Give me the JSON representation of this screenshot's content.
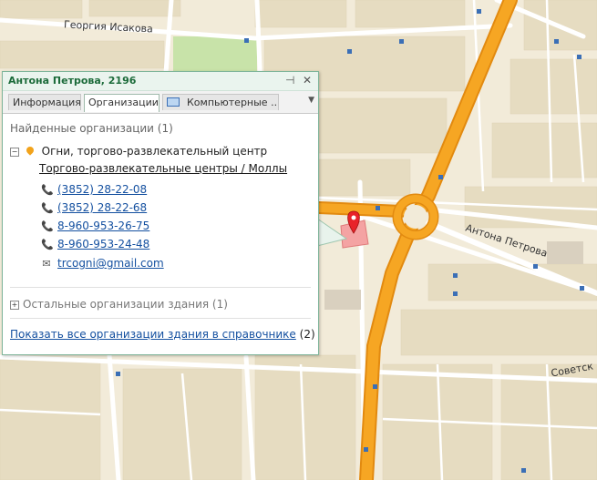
{
  "map": {
    "streets": {
      "georgia_isakova": "Георгия Исакова",
      "antona_petrova": "Антона Петрова",
      "sovetsk": "Советск"
    },
    "colors": {
      "background": "#f2ebd9",
      "block": "#e6dcc1",
      "park": "#c8e3a9",
      "highway": "#f6a623",
      "street": "#ffffff",
      "building": "#f4a3a3",
      "marker": "#e8232a"
    }
  },
  "popup": {
    "title": "Антона Петрова, 2196",
    "pin_icon": "pin-icon",
    "close_icon": "close-icon",
    "tabs": [
      "Информация",
      "Организации",
      "Компьютерные ..."
    ],
    "active_tab": "Организации",
    "found_title": "Найденные организации (1)",
    "org": {
      "name": "Огни, торгово-развлекательный центр",
      "category": "Торгово-развлекательные центры / Моллы",
      "contacts": [
        {
          "icon": "phone-icon",
          "text": "(3852) 28-22-08"
        },
        {
          "icon": "phone-icon",
          "text": "(3852) 28-22-68"
        },
        {
          "icon": "phone-icon",
          "text": "8-960-953-26-75"
        },
        {
          "icon": "phone-icon",
          "text": "8-960-953-24-48"
        },
        {
          "icon": "mail-icon",
          "text": "trcogni@gmail.com"
        }
      ]
    },
    "other_orgs": "Остальные организации здания (1)",
    "show_all_link": "Показать все организации здания в справочнике",
    "show_all_count": "(2)"
  }
}
